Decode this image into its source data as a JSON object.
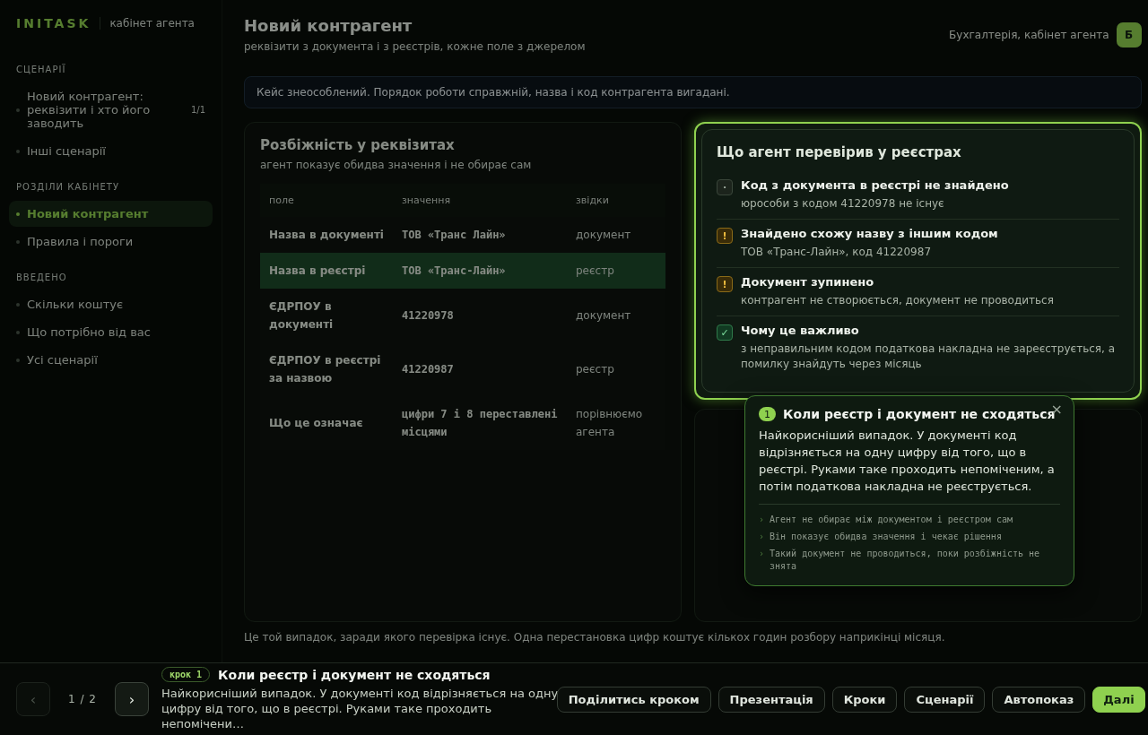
{
  "sidebar": {
    "logo": "INITASK",
    "subtitle": "кабінет агента",
    "sections": [
      {
        "title": "СЦЕНАРІЇ",
        "items": [
          {
            "label": "Новий контрагент: реквізити і хто його заводить",
            "count": "1/1",
            "selected": false
          },
          {
            "label": "Інші сценарії",
            "selected": false
          }
        ]
      },
      {
        "title": "РОЗДІЛИ КАБІНЕТУ",
        "items": [
          {
            "label": "Новий контрагент",
            "selected": true
          },
          {
            "label": "Правила і пороги",
            "selected": false
          }
        ]
      },
      {
        "title": "ВВЕДЕНО",
        "items": [
          {
            "label": "Скільки коштує",
            "selected": false
          },
          {
            "label": "Що потрібно від вас",
            "selected": false
          },
          {
            "label": "Усі сценарії",
            "selected": false
          }
        ]
      }
    ]
  },
  "header": {
    "title": "Новий контрагент",
    "subtitle": "реквізити з документа і з реєстрів, кожне поле з джерелом",
    "user": "Бухгалтерія, кабінет агента",
    "avatar": "Б"
  },
  "notice": "Кейс знеособлений. Порядок роботи справжній, назва і код контрагента вигадані.",
  "diff_table": {
    "title": "Розбіжність у реквізитах",
    "subtitle": "агент показує обидва значення і не обирає сам",
    "columns": [
      "поле",
      "значення",
      "звідки"
    ],
    "rows": [
      {
        "cells": [
          "Назва в документі",
          "ТОВ «Транс Лайн»",
          "документ"
        ],
        "highlighted": false
      },
      {
        "cells": [
          "Назва в реєстрі",
          "ТОВ «Транс-Лайн»",
          "реєстр"
        ],
        "highlighted": true
      },
      {
        "cells": [
          "ЄДРПОУ в документі",
          "41220978",
          "документ"
        ],
        "highlighted": false
      },
      {
        "cells": [
          "ЄДРПОУ в реєстрі за назвою",
          "41220987",
          "реєстр"
        ],
        "highlighted": false
      },
      {
        "cells": [
          "Що це означає",
          "цифри 7 і 8 переставлені місцями",
          "порівнюємо агента"
        ],
        "highlighted": false
      }
    ]
  },
  "check_card": {
    "title": "Що агент перевірив у реєстрах",
    "focused": true,
    "items": [
      {
        "kind": "neutral",
        "mark": "·",
        "title": "Код з документа в реєстрі не знайдено",
        "text": "юрособи з кодом 41220978 не існує"
      },
      {
        "kind": "warning",
        "mark": "!",
        "title": "Знайдено схожу назву з іншим кодом",
        "text": "ТОВ «Транс-Лайн», код 41220987"
      },
      {
        "kind": "warning",
        "mark": "!",
        "title": "Документ зупинено",
        "text": "контрагент не створюється, документ не проводиться"
      },
      {
        "kind": "ok",
        "mark": "✓",
        "title": "Чому це важливо",
        "text": "з неправильним кодом податкова накладна не зареєструється, а помилку знайдуть через місяць"
      }
    ]
  },
  "caption": "Це той випадок, заради якого перевірка існує. Одна перестановка цифр коштує кількох годин розбору наприкінці місяця.",
  "popover": {
    "number": "1",
    "title": "Коли реєстр і документ не сходяться",
    "close": "×",
    "body": "Найкорисніший випадок. У документі код відрізняється на одну цифру від того, що в реєстрі. Руками таке проходить непоміченим, а потім податкова накладна не реєструється.",
    "points": [
      {
        "mark": "›",
        "text": "Агент не обирає між документом і реєстром сам"
      },
      {
        "mark": "›",
        "text": "Він показує обидва значення і чекає рішення"
      },
      {
        "mark": "›",
        "text": "Такий документ не проводиться, поки розбіжність не знята"
      }
    ]
  },
  "tour_bar": {
    "prev": {
      "label": "‹",
      "disabled": true
    },
    "position": "1 / 2",
    "next": {
      "label": "›",
      "disabled": false
    },
    "step_tag": "крок 1",
    "title": "Коли реєстр і документ не сходяться",
    "text": "Найкорисніший випадок. У документі код відрізняється на одну цифру від того, що в реєстрі. Руками таке проходить непомічени…",
    "buttons": [
      {
        "label": "Поділитись кроком",
        "kind": "secondary"
      },
      {
        "label": "Презентація",
        "kind": "secondary"
      },
      {
        "label": "Кроки",
        "kind": "secondary"
      },
      {
        "label": "Сценарії",
        "kind": "secondary"
      },
      {
        "label": "Автопоказ",
        "kind": "secondary"
      },
      {
        "label": "Далі",
        "kind": "primary"
      }
    ]
  }
}
